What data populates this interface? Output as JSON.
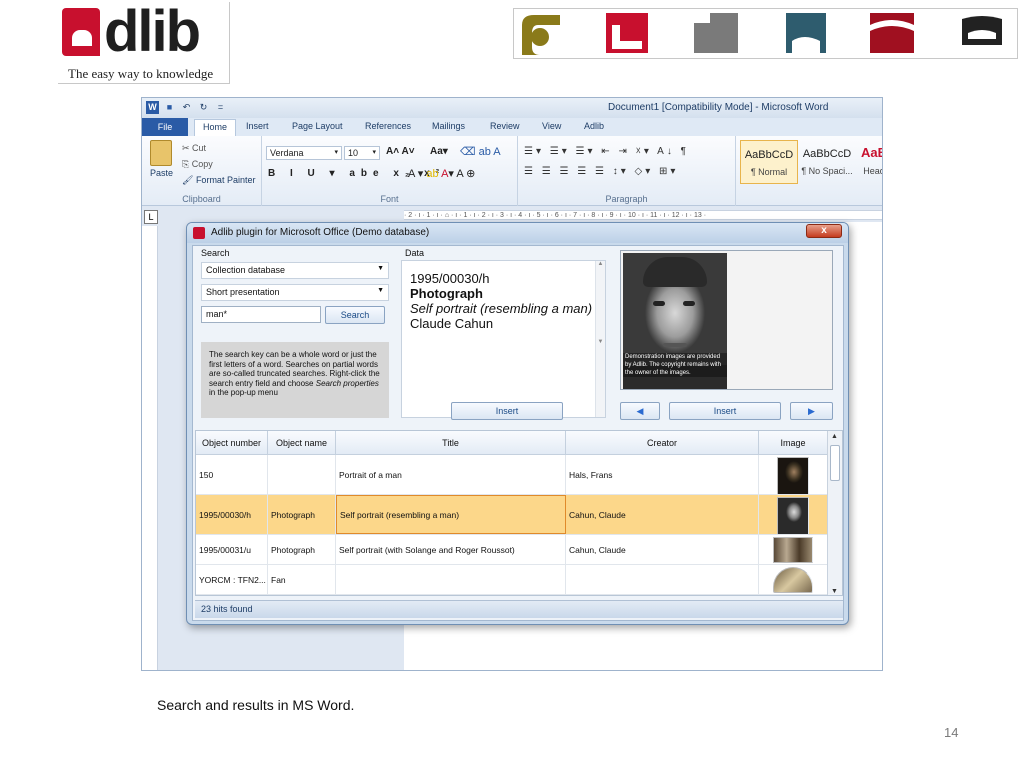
{
  "brand": {
    "logo_text": "dlib",
    "tagline": "The easy way to knowledge",
    "tile_colors": [
      "#8a7a1a",
      "#c8102e",
      "#7a7a7a",
      "#2e5c6e",
      "#a01020",
      "#222222"
    ]
  },
  "word": {
    "window_title": "Document1 [Compatibility Mode] - Microsoft Word",
    "quick_access": [
      "W",
      "■",
      "↶",
      "↻",
      "="
    ],
    "tabs": [
      "File",
      "Home",
      "Insert",
      "Page Layout",
      "References",
      "Mailings",
      "Review",
      "View",
      "Adlib"
    ],
    "clipboard": {
      "paste": "Paste",
      "cut": "Cut",
      "copy": "Copy",
      "format_painter": "Format Painter",
      "group": "Clipboard"
    },
    "font": {
      "family": "Verdana",
      "size": "10",
      "group": "Font",
      "format_row": "B I U ▾ abe x₂ x²"
    },
    "paragraph": {
      "group": "Paragraph",
      "row1": "☰▾ ☰▾ ☰▾ ⇤ ⇥ ☓▾ A↓ ¶",
      "row2": "☰ ☰ ☰ ☰ ☰ ↕▾ ◇▾ ⊞▾"
    },
    "styles": [
      {
        "preview": "AaBbCcD",
        "name": "¶ Normal"
      },
      {
        "preview": "AaBbCcD",
        "name": "¶ No Spaci..."
      },
      {
        "preview": "AaB",
        "name": "Head"
      }
    ],
    "ruler_text": "· 2 · ı · 1 · ı · ⌂ · ı · 1 · ı · 2 · ı · 3 · ı · 4 · ı · 5 · ı · 6 · ı · 7 · ı · 8 · ı · 9 · ı · 10 · ı · 11 · ı · 12 · ı · 13 ·",
    "ruler_button": "L"
  },
  "plugin": {
    "title": "Adlib plugin for Microsoft Office (Demo database)",
    "close": "x",
    "search_label": "Search",
    "database": "Collection database",
    "presentation": "Short presentation",
    "query": "man*",
    "search_button": "Search",
    "help_text_1": "The search key can be a whole word or just the first letters of a word. Searches on partial words are so-called truncated searches. Right-click the search entry field and choose ",
    "help_text_em": "Search properties",
    "help_text_2": " in the pop-up menu",
    "data_label": "Data",
    "record": {
      "number": "1995/00030/h",
      "object_name": "Photograph",
      "title": "Self portrait (resembling a man)",
      "creator": "Claude Cahun"
    },
    "image_note": "Demonstration images are provided by Adlib. The copyright remains with the owner of the images.",
    "insert_data": "Insert",
    "insert_image": "Insert",
    "prev_icon": "◀",
    "next_icon": "▶",
    "columns": [
      "Object number",
      "Object name",
      "Title",
      "Creator",
      "Image"
    ],
    "rows": [
      {
        "number": "150",
        "name": "",
        "title": "Portrait of a man",
        "creator": "Hals, Frans",
        "selected": false
      },
      {
        "number": "1995/00030/h",
        "name": "Photograph",
        "title": "Self portrait (resembling a man)",
        "creator": "Cahun, Claude",
        "selected": true
      },
      {
        "number": "1995/00031/u",
        "name": "Photograph",
        "title": "Self portrait (with Solange and Roger Roussot)",
        "creator": "Cahun, Claude",
        "selected": false
      },
      {
        "number": "YORCM : TFN2...",
        "name": "Fan",
        "title": "",
        "creator": "",
        "selected": false
      }
    ],
    "status": "23 hits found",
    "selection_color": "#fcd78a"
  },
  "caption": "Search and results in MS Word.",
  "page_number": "14"
}
